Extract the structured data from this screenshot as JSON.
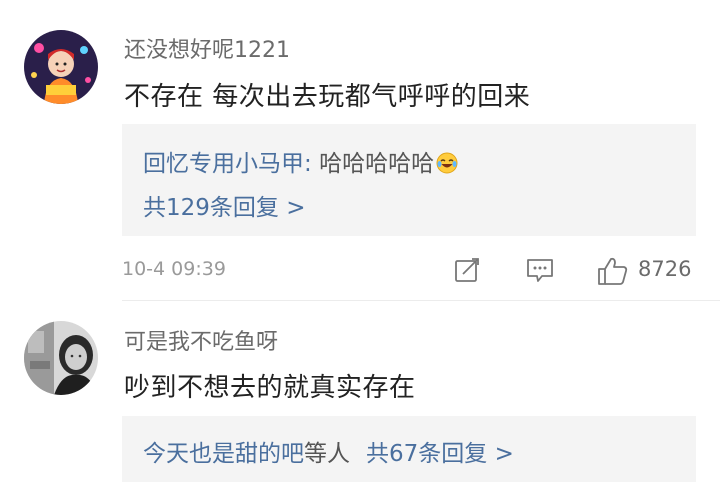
{
  "comments": [
    {
      "username": "还没想好呢1221",
      "content": "不存在 每次出去玩都气呼呼的回来",
      "reply_preview": {
        "author": "回忆专用小马甲",
        "separator": ": ",
        "text": "哈哈哈哈哈",
        "emoji": "laugh-cry-emoji"
      },
      "reply_count_label": "共129条回复 >",
      "time": "10-4 09:39",
      "likes": "8726"
    },
    {
      "username": "可是我不吃鱼呀",
      "content": "吵到不想去的就真实存在",
      "reply_preview": {
        "author": "今天也是甜的吧",
        "text": "等人",
        "reply_count_label": "共67条回复 >"
      }
    }
  ],
  "colors": {
    "link_blue": "#4a6f9e",
    "reply_bg": "#f4f4f4",
    "meta_gray": "#9a9a9a",
    "text": "#222222"
  },
  "icons": [
    "share-icon",
    "comment-icon",
    "like-icon"
  ]
}
